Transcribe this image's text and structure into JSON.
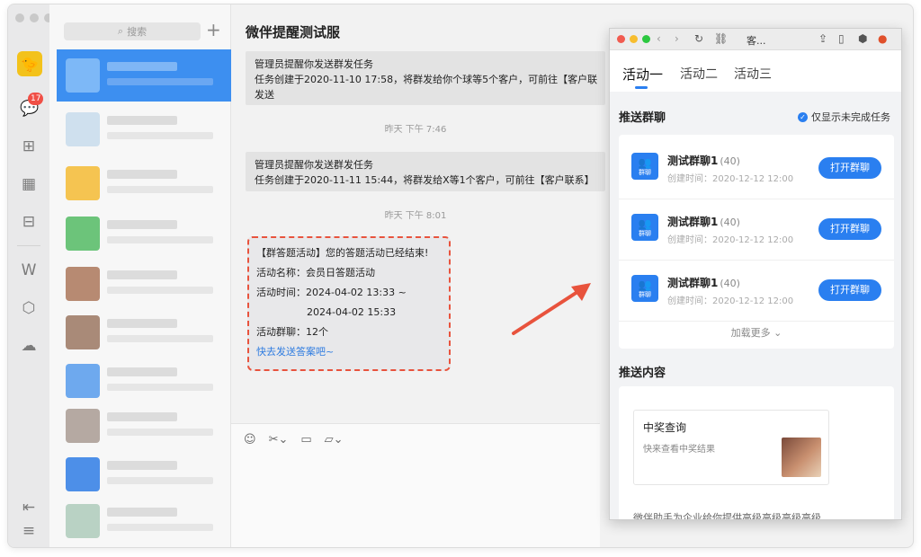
{
  "rail": {
    "unread_badge": "17"
  },
  "convlist": {
    "search_placeholder": "搜索"
  },
  "chat": {
    "title": "微伴提醒测试服",
    "messages": [
      {
        "line1": "管理员提醒你发送群发任务",
        "line2": "任务创建于2020-11-10 17:58，将群发给你个球等5个客户，可前往【客户联",
        "line3": "发送"
      },
      {
        "line1": "管理员提醒你发送群发任务",
        "line2": "任务创建于2020-11-11 15:44，将群发给X等1个客户，可前往【客户联系】"
      }
    ],
    "times": [
      "昨天 下午 7:46",
      "昨天 下午 8:01"
    ],
    "activity_card": {
      "header": "【群答题活动】您的答题活动已经结束!",
      "name": "活动名称：会员日答题活动",
      "time_start": "活动时间：2024-04-02 13:33 ~",
      "time_end": "2024-04-02 15:33",
      "groups": "活动群聊：12个",
      "link": "快去发送答案吧~"
    }
  },
  "panel": {
    "window_title": "客...",
    "tabs": [
      "活动一",
      "活动二",
      "活动三"
    ],
    "push_groups_title": "推送群聊",
    "only_unfinished": "仅显示未完成任务",
    "group_icon_label": "群聊",
    "groups": [
      {
        "name": "测试群聊1",
        "count": "(40)",
        "created": "创建时间：2020-12-12 12:00",
        "button": "打开群聊"
      },
      {
        "name": "测试群聊1",
        "count": "(40)",
        "created": "创建时间：2020-12-12 12:00",
        "button": "打开群聊"
      },
      {
        "name": "测试群聊1",
        "count": "(40)",
        "created": "创建时间：2020-12-12 12:00",
        "button": "打开群聊"
      }
    ],
    "load_more": "加载更多",
    "push_content_title": "推送内容",
    "content_card": {
      "title": "中奖查询",
      "subtitle": "快来查看中奖结果"
    },
    "content_footer": "微伴助手为企业给你提供高级高级高级高级"
  },
  "colors": {
    "accent": "#2a7ff0",
    "highlight_arrow": "#e8533d",
    "badge": "#f04f46"
  }
}
